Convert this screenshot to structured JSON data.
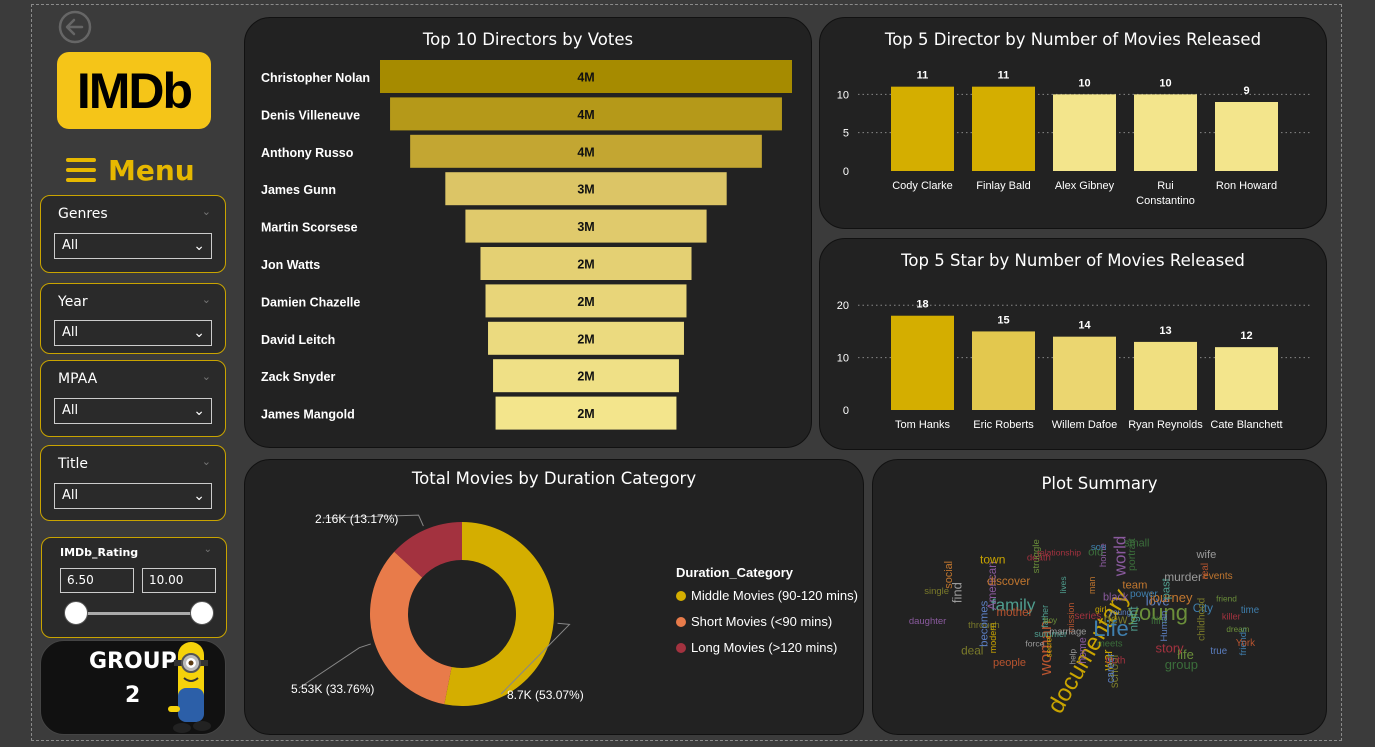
{
  "app": {
    "logo": "IMDb",
    "menu_label": "Menu"
  },
  "filters": [
    {
      "label": "Genres",
      "value": "All"
    },
    {
      "label": "Year",
      "value": "All"
    },
    {
      "label": "MPAA",
      "value": "All"
    },
    {
      "label": "Title",
      "value": "All"
    }
  ],
  "rating_filter": {
    "label": "IMDb_Rating",
    "min": "6.50",
    "max": "10.00"
  },
  "group": {
    "line1": "GROUP",
    "line2": "2"
  },
  "colors": {
    "gold_dark": "#a68b00",
    "gold": "#d4ae00",
    "gold_light": "#f3e58c",
    "orange": "#e87b4a",
    "maroon": "#a3323f",
    "panel": "#222222"
  },
  "chart_data": [
    {
      "type": "bar",
      "title": "Top 10 Directors by Votes",
      "orientation": "horizontal-funnel",
      "categories": [
        "Christopher Nolan",
        "Denis Villeneuve",
        "Anthony Russo",
        "James Gunn",
        "Martin Scorsese",
        "Jon Watts",
        "Damien Chazelle",
        "David Leitch",
        "Zack Snyder",
        "James Mangold"
      ],
      "values": [
        4.1,
        3.9,
        3.5,
        2.8,
        2.4,
        2.1,
        2.0,
        1.95,
        1.85,
        1.8
      ],
      "labels": [
        "4M",
        "4M",
        "4M",
        "3M",
        "3M",
        "2M",
        "2M",
        "2M",
        "2M",
        "2M"
      ]
    },
    {
      "type": "bar",
      "title": "Top 5 Director by Number of Movies Released",
      "categories": [
        "Cody Clarke",
        "Finlay Bald",
        "Alex Gibney",
        "Rui Constantino",
        "Ron Howard"
      ],
      "category_lines": [
        [
          "Cody Clarke"
        ],
        [
          "Finlay Bald"
        ],
        [
          "Alex Gibney"
        ],
        [
          "Rui",
          "Constantino"
        ],
        [
          "Ron Howard"
        ]
      ],
      "values": [
        11,
        11,
        10,
        10,
        9
      ],
      "yticks": [
        0,
        5,
        10
      ],
      "ylim": [
        0,
        12
      ],
      "grid": true
    },
    {
      "type": "bar",
      "title": "Top 5 Star by Number of Movies Released",
      "categories": [
        "Tom Hanks",
        "Eric Roberts",
        "Willem Dafoe",
        "Ryan Reynolds",
        "Cate Blanchett"
      ],
      "values": [
        18,
        15,
        14,
        13,
        12
      ],
      "yticks": [
        0,
        10,
        20
      ],
      "ylim": [
        0,
        21
      ],
      "grid": true
    },
    {
      "type": "pie",
      "subtype": "donut",
      "title": "Total Movies by Duration Category",
      "legend_title": "Duration_Category",
      "legend_position": "right",
      "categories": [
        "Middle Movies (90-120 mins)",
        "Short Movies (<90 mins)",
        "Long Movies (>120 mins)"
      ],
      "values": [
        8700,
        5530,
        2160
      ],
      "labels": [
        "8.7K (53.07%)",
        "5.53K (33.76%)",
        "2.16K (13.17%)"
      ],
      "colors": [
        "#d4ae00",
        "#e87b4a",
        "#a3323f"
      ]
    }
  ],
  "wordcloud": {
    "title": "Plot Summary",
    "words": [
      "documentary",
      "young",
      "Life",
      "woman",
      "world",
      "family",
      "story",
      "new",
      "love",
      "journey",
      "find",
      "group",
      "war",
      "life",
      "friends",
      "mother",
      "home",
      "father",
      "death",
      "through",
      "becomes",
      "man",
      "wife",
      "old",
      "secret",
      "struggle",
      "City",
      "York",
      "American",
      "past",
      "relationship",
      "school",
      "young",
      "team",
      "help",
      "meets",
      "girl",
      "boy",
      "time",
      "people",
      "home",
      "night",
      "killer",
      "single",
      "true",
      "events",
      "murder",
      "small",
      "town",
      "friend",
      "son",
      "real",
      "daughter",
      "lives",
      "series",
      "childhood",
      "career",
      "discover",
      "force",
      "film",
      "modern",
      "dream",
      "power",
      "mission",
      "black",
      "summer",
      "truth",
      "deal",
      "Human",
      "social",
      "marriage",
      "portrait"
    ]
  }
}
